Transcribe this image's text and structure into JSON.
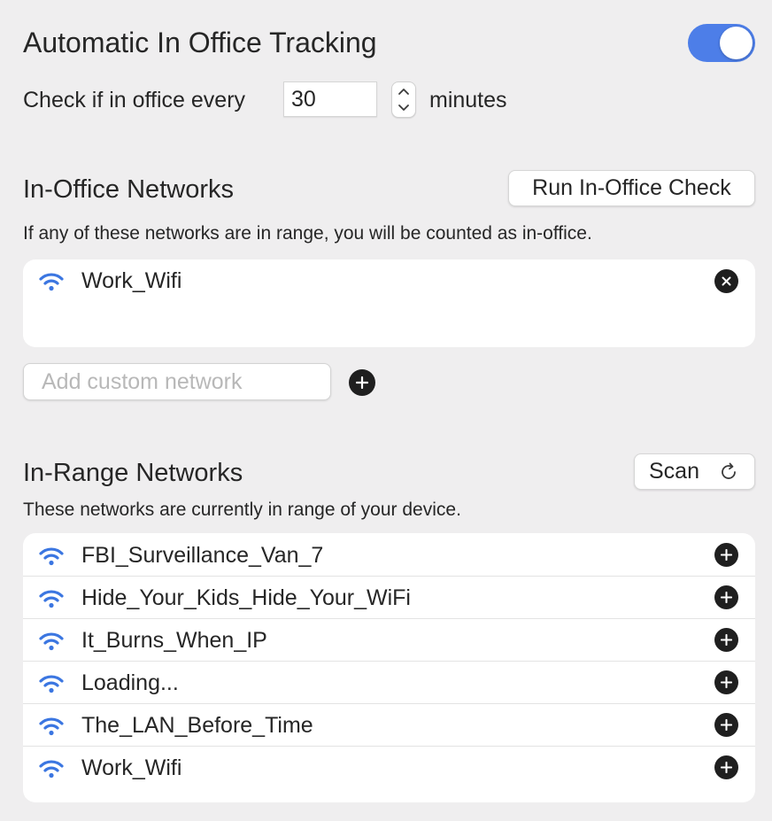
{
  "tracking": {
    "title": "Automatic In Office Tracking",
    "enabled": true
  },
  "interval": {
    "label": "Check if in office every",
    "value": "30",
    "unit_label": "minutes"
  },
  "in_office": {
    "title": "In-Office Networks",
    "run_check_label": "Run In-Office Check",
    "description": "If any of these networks are in range, you will be counted as in-office.",
    "networks": [
      "Work_Wifi"
    ],
    "add_placeholder": "Add custom network"
  },
  "in_range": {
    "title": "In-Range Networks",
    "scan_label": "Scan",
    "description": "These networks are currently in range of your device.",
    "networks": [
      "FBI_Surveillance_Van_7",
      "Hide_Your_Kids_Hide_Your_WiFi",
      "It_Burns_When_IP",
      "Loading...",
      "The_LAN_Before_Time",
      "Work_Wifi"
    ]
  },
  "colors": {
    "accent": "#4d7ee8",
    "wifi": "#3b76e1",
    "background": "#efeeef"
  }
}
